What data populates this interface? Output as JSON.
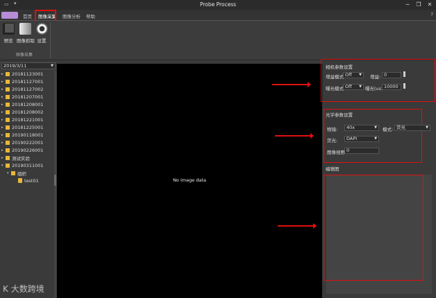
{
  "window": {
    "title": "Probe Process"
  },
  "quick_access": {
    "a": "▭",
    "b": "▾"
  },
  "window_buttons": {
    "minimize": "─",
    "restore": "❐",
    "close": "✕"
  },
  "tabs": [
    {
      "label": "首页"
    },
    {
      "label": "图像采集"
    },
    {
      "label": "图像分析"
    },
    {
      "label": "帮助"
    }
  ],
  "ribbon_help": "?",
  "ribbon": {
    "buttons": [
      {
        "label": "预览"
      },
      {
        "label": "图像抓取"
      },
      {
        "label": "设置"
      }
    ],
    "group_label": "图像采集"
  },
  "left": {
    "date": "2019/3/11",
    "tree": [
      {
        "label": "20181123001",
        "kind": "folder"
      },
      {
        "label": "20181127001",
        "kind": "folder"
      },
      {
        "label": "20181127002",
        "kind": "folder"
      },
      {
        "label": "20181207001",
        "kind": "folder"
      },
      {
        "label": "20181208001",
        "kind": "folder"
      },
      {
        "label": "20181208002",
        "kind": "folder"
      },
      {
        "label": "20181221001",
        "kind": "folder"
      },
      {
        "label": "20181225001",
        "kind": "folder"
      },
      {
        "label": "20190118001",
        "kind": "folder"
      },
      {
        "label": "20190222001",
        "kind": "folder"
      },
      {
        "label": "20190226001",
        "kind": "folder"
      },
      {
        "label": "测试实验",
        "kind": "folder"
      },
      {
        "label": "20190311001",
        "kind": "folder-open"
      },
      {
        "label": "组织",
        "kind": "folder-open-child"
      },
      {
        "label": "test01",
        "kind": "page"
      }
    ]
  },
  "viewer": {
    "no_image": "No image data"
  },
  "camera": {
    "title": "相机参数设置",
    "gain_mode_label": "增益模式:",
    "gain_mode_value": "Off",
    "gain_label": "增益:",
    "gain_value": "0",
    "exposure_mode_label": "曝光模式:",
    "exposure_mode_value": "Off",
    "exposure_label": "曝光(us):",
    "exposure_value": "10000"
  },
  "optics": {
    "title": "光学参数设置",
    "objective_label": "物镜:",
    "objective_value": "40x",
    "mode_label": "模式:",
    "mode_value": "荧光",
    "stain_label": "荧光:",
    "stain_value": "DAPI",
    "fov_label": "图像视野:",
    "fov_value": "0"
  },
  "edit": {
    "title": "编辑图"
  },
  "watermark": {
    "text": "大数跨境",
    "logo": "K"
  }
}
